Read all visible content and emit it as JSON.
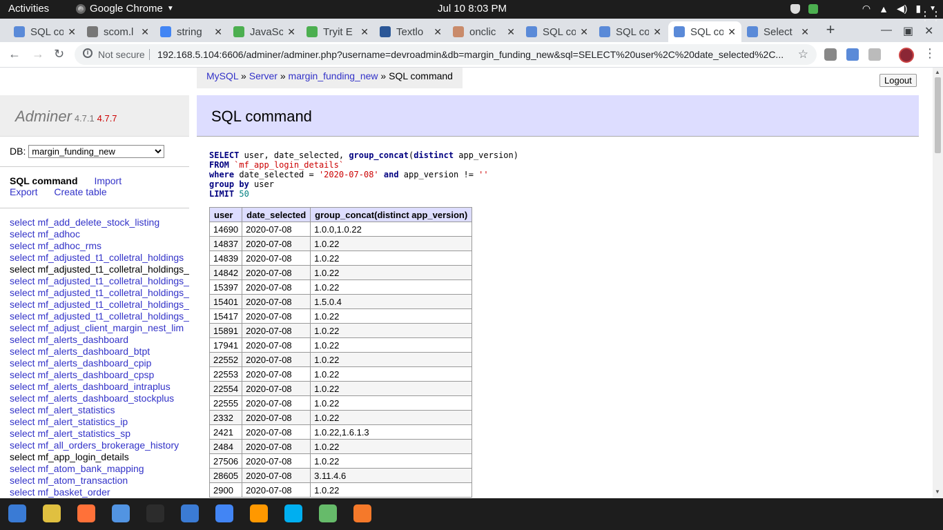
{
  "topbar": {
    "activities": "Activities",
    "app_name": "Google Chrome",
    "clock": "Jul 10   8:03 PM"
  },
  "tabs": [
    {
      "title": "SQL co",
      "favicon_color": "#5a8ad8"
    },
    {
      "title": "scom.l",
      "favicon_color": "#777777"
    },
    {
      "title": "string",
      "favicon_color": "#4285f4"
    },
    {
      "title": "JavaSc",
      "favicon_color": "#4caf50"
    },
    {
      "title": "Tryit E",
      "favicon_color": "#4caf50"
    },
    {
      "title": "Textlo",
      "favicon_color": "#2b5797"
    },
    {
      "title": "onclic",
      "favicon_color": "#c98b6b"
    },
    {
      "title": "SQL co",
      "favicon_color": "#5a8ad8"
    },
    {
      "title": "SQL co",
      "favicon_color": "#5a8ad8"
    },
    {
      "title": "SQL co",
      "favicon_color": "#5a8ad8"
    },
    {
      "title": "Select",
      "favicon_color": "#5a8ad8"
    }
  ],
  "toolbar": {
    "security_label": "Not secure",
    "url": "192.168.5.104:6606/adminer/adminer.php?username=devroadmin&db=margin_funding_new&sql=SELECT%20user%2C%20date_selected%2C..."
  },
  "breadcrumb": {
    "mysql": "MySQL",
    "sep1": " » ",
    "server": "Server",
    "sep2": " » ",
    "db": "margin_funding_new",
    "sep3": " » ",
    "current": "SQL command"
  },
  "logout_label": "Logout",
  "menu": {
    "app_name": "Adminer",
    "version": "4.7.1",
    "new_version": "4.7.7",
    "db_label": "DB:",
    "db_selected": "margin_funding_new",
    "links": {
      "sql_command": "SQL command",
      "import": "Import",
      "export": "Export",
      "create_table": "Create table"
    },
    "tables": [
      "select mf_add_delete_stock_listing",
      "select mf_adhoc",
      "select mf_adhoc_rms",
      "select mf_adjusted_t1_colletral_holdings",
      "select mf_adjusted_t1_colletral_holdings_",
      "select mf_adjusted_t1_colletral_holdings_",
      "select mf_adjusted_t1_colletral_holdings_",
      "select mf_adjusted_t1_colletral_holdings_",
      "select mf_adjusted_t1_colletral_holdings_",
      "select mf_adjust_client_margin_nest_lim",
      "select mf_alerts_dashboard",
      "select mf_alerts_dashboard_btpt",
      "select mf_alerts_dashboard_cpip",
      "select mf_alerts_dashboard_cpsp",
      "select mf_alerts_dashboard_intraplus",
      "select mf_alerts_dashboard_stockplus",
      "select mf_alert_statistics",
      "select mf_alert_statistics_ip",
      "select mf_alert_statistics_sp",
      "select mf_all_orders_brokerage_history",
      "select mf_app_login_details",
      "select mf_atom_bank_mapping",
      "select mf_atom_transaction",
      "select mf_basket_order"
    ],
    "current_table_index": 20,
    "black_table_index": 4
  },
  "content": {
    "title": "SQL command",
    "sql": {
      "l1_kw": "SELECT",
      "l1_rest": " user, date_selected, ",
      "l1_kw2": "group_concat",
      "l1_p1": "(",
      "l1_kw3": "distinct",
      "l1_p2": " app_version)",
      "l2_kw": "FROM",
      "l2_rest": " ",
      "l2_tbl": "`mf_app_login_details`",
      "l3_kw": "where",
      "l3_a": " date_selected = ",
      "l3_str": "'2020-07-08'",
      "l3_sp": " ",
      "l3_kw2": "and",
      "l3_b": " app_version != ",
      "l3_str2": "''",
      "l4_kw": "group by",
      "l4_rest": " user",
      "l5_kw": "LIMIT",
      "l5_sp": " ",
      "l5_num": "50"
    },
    "columns": [
      "user",
      "date_selected",
      "group_concat(distinct app_version)"
    ],
    "rows": [
      [
        "14690",
        "2020-07-08",
        "1.0.0,1.0.22"
      ],
      [
        "14837",
        "2020-07-08",
        "1.0.22"
      ],
      [
        "14839",
        "2020-07-08",
        "1.0.22"
      ],
      [
        "14842",
        "2020-07-08",
        "1.0.22"
      ],
      [
        "15397",
        "2020-07-08",
        "1.0.22"
      ],
      [
        "15401",
        "2020-07-08",
        "1.5.0.4"
      ],
      [
        "15417",
        "2020-07-08",
        "1.0.22"
      ],
      [
        "15891",
        "2020-07-08",
        "1.0.22"
      ],
      [
        "17941",
        "2020-07-08",
        "1.0.22"
      ],
      [
        "22552",
        "2020-07-08",
        "1.0.22"
      ],
      [
        "22553",
        "2020-07-08",
        "1.0.22"
      ],
      [
        "22554",
        "2020-07-08",
        "1.0.22"
      ],
      [
        "22555",
        "2020-07-08",
        "1.0.22"
      ],
      [
        "2332",
        "2020-07-08",
        "1.0.22"
      ],
      [
        "2421",
        "2020-07-08",
        "1.0.22,1.6.1.3"
      ],
      [
        "2484",
        "2020-07-08",
        "1.0.22"
      ],
      [
        "27506",
        "2020-07-08",
        "1.0.22"
      ],
      [
        "28605",
        "2020-07-08",
        "3.11.4.6"
      ],
      [
        "2900",
        "2020-07-08",
        "1.0.22"
      ]
    ]
  },
  "dock": [
    {
      "name": "thunderbird-icon",
      "color": "#3a7bd5"
    },
    {
      "name": "rhythmbox-icon",
      "color": "#e0c040"
    },
    {
      "name": "firefox-icon",
      "color": "#ff7139"
    },
    {
      "name": "files-icon",
      "color": "#5294e2"
    },
    {
      "name": "terminal-icon",
      "color": "#2c2c2c"
    },
    {
      "name": "writer-icon",
      "color": "#3b7bd4"
    },
    {
      "name": "chrome-icon",
      "color": "#4285f4"
    },
    {
      "name": "sublime-icon",
      "color": "#ff9800"
    },
    {
      "name": "skype-icon",
      "color": "#00aff0"
    },
    {
      "name": "atom-icon",
      "color": "#66bb6a"
    },
    {
      "name": "blender-icon",
      "color": "#f5792a"
    }
  ]
}
